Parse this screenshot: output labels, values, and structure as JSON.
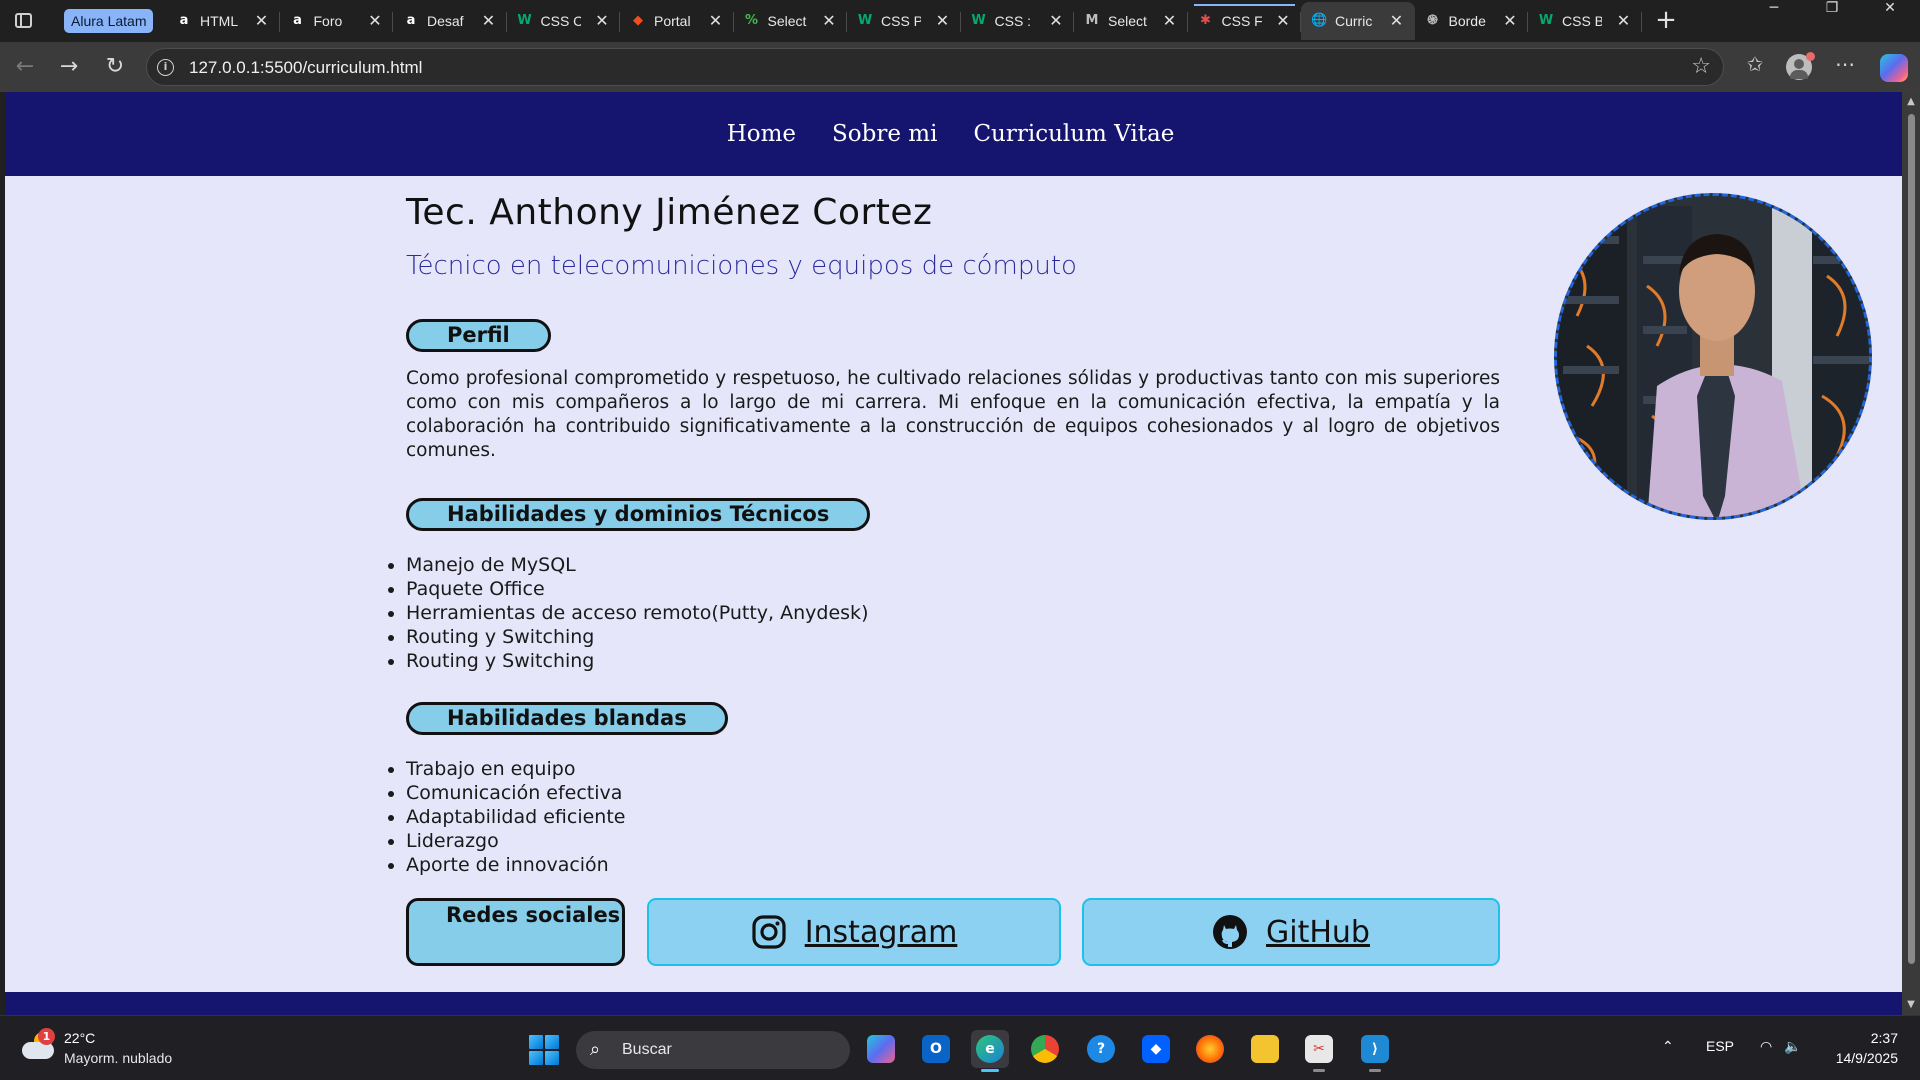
{
  "browser": {
    "tab_group": "Alura Latam",
    "tabs": [
      {
        "title": "HTML",
        "icon": "alura-icon",
        "glyph": "a",
        "color": "#ffffff",
        "bg": "transparent"
      },
      {
        "title": "Foro",
        "icon": "alura-icon",
        "glyph": "a",
        "color": "#ffffff",
        "bg": "transparent"
      },
      {
        "title": "Desaf",
        "icon": "alura-icon",
        "glyph": "a",
        "color": "#ffffff",
        "bg": "transparent"
      },
      {
        "title": "CSS C",
        "icon": "w3schools-icon",
        "glyph": "W",
        "color": "#04aa6d",
        "bg": "transparent"
      },
      {
        "title": "Portal",
        "icon": "figma-icon",
        "glyph": "◆",
        "color": "#f24e1e",
        "bg": "transparent"
      },
      {
        "title": "Select",
        "icon": "select-icon",
        "glyph": "%",
        "color": "#3fb950",
        "bg": "transparent"
      },
      {
        "title": "CSS P",
        "icon": "w3schools-icon",
        "glyph": "W",
        "color": "#04aa6d",
        "bg": "transparent"
      },
      {
        "title": "CSS :",
        "icon": "w3schools-icon",
        "glyph": "W",
        "color": "#04aa6d",
        "bg": "transparent"
      },
      {
        "title": "Select",
        "icon": "mdn-icon",
        "glyph": "M",
        "color": "#bdbdbd",
        "bg": "transparent"
      },
      {
        "title": "CSS F",
        "icon": "asterisk-icon",
        "glyph": "✱",
        "color": "#e05050",
        "bg": "transparent"
      },
      {
        "title": "Curric",
        "icon": "globe-icon",
        "glyph": "🌐",
        "color": "#e0e0e0",
        "bg": "transparent"
      },
      {
        "title": "Borde",
        "icon": "openai-icon",
        "glyph": "֍",
        "color": "#bdbdbd",
        "bg": "transparent"
      },
      {
        "title": "CSS B",
        "icon": "w3schools-icon",
        "glyph": "W",
        "color": "#04aa6d",
        "bg": "transparent"
      }
    ],
    "active_tab_index": 10,
    "url": "127.0.0.1:5500/curriculum.html"
  },
  "site": {
    "nav": [
      "Home",
      "Sobre mi",
      "Curriculum Vitae"
    ],
    "name": "Tec. Anthony Jiménez Cortez",
    "subtitle": "Técnico en telecomuniciones y equipos de cómputo",
    "profile_label": "Perfil",
    "profile_text": "Como profesional comprometido y respetuoso, he cultivado relaciones sólidas y productivas tanto con mis superiores como con mis compañeros a lo largo de mi carrera. Mi enfoque en la comunicación efectiva, la empatía y la colaboración ha contribuido significativamente a la construcción de equipos cohesionados y al logro de objetivos comunes.",
    "tech_label": "Habilidades y dominios Técnicos",
    "tech_skills": [
      "Manejo de MySQL",
      "Paquete Office",
      "Herramientas de acceso remoto(Putty, Anydesk)",
      "Routing y Switching",
      "Routing y Switching"
    ],
    "soft_label": "Habilidades blandas",
    "soft_skills": [
      "Trabajo en equipo",
      "Comunicación efectiva",
      "Adaptabilidad eficiente",
      "Liderazgo",
      "Aporte de innovación"
    ],
    "social_label": "Redes sociales",
    "instagram_label": "Instagram",
    "github_label": "GitHub"
  },
  "taskbar": {
    "weather_temp": "22°C",
    "weather_desc": "Mayorm. nublado",
    "weather_badge": "1",
    "search_placeholder": "Buscar",
    "language": "ESP",
    "time": "2:37",
    "date": "14/9/2025"
  },
  "colors": {
    "header_bg": "#151570",
    "page_bg": "#e6e6fa",
    "pill_bg": "#86cdea",
    "social_border": "#1ec2e8"
  }
}
